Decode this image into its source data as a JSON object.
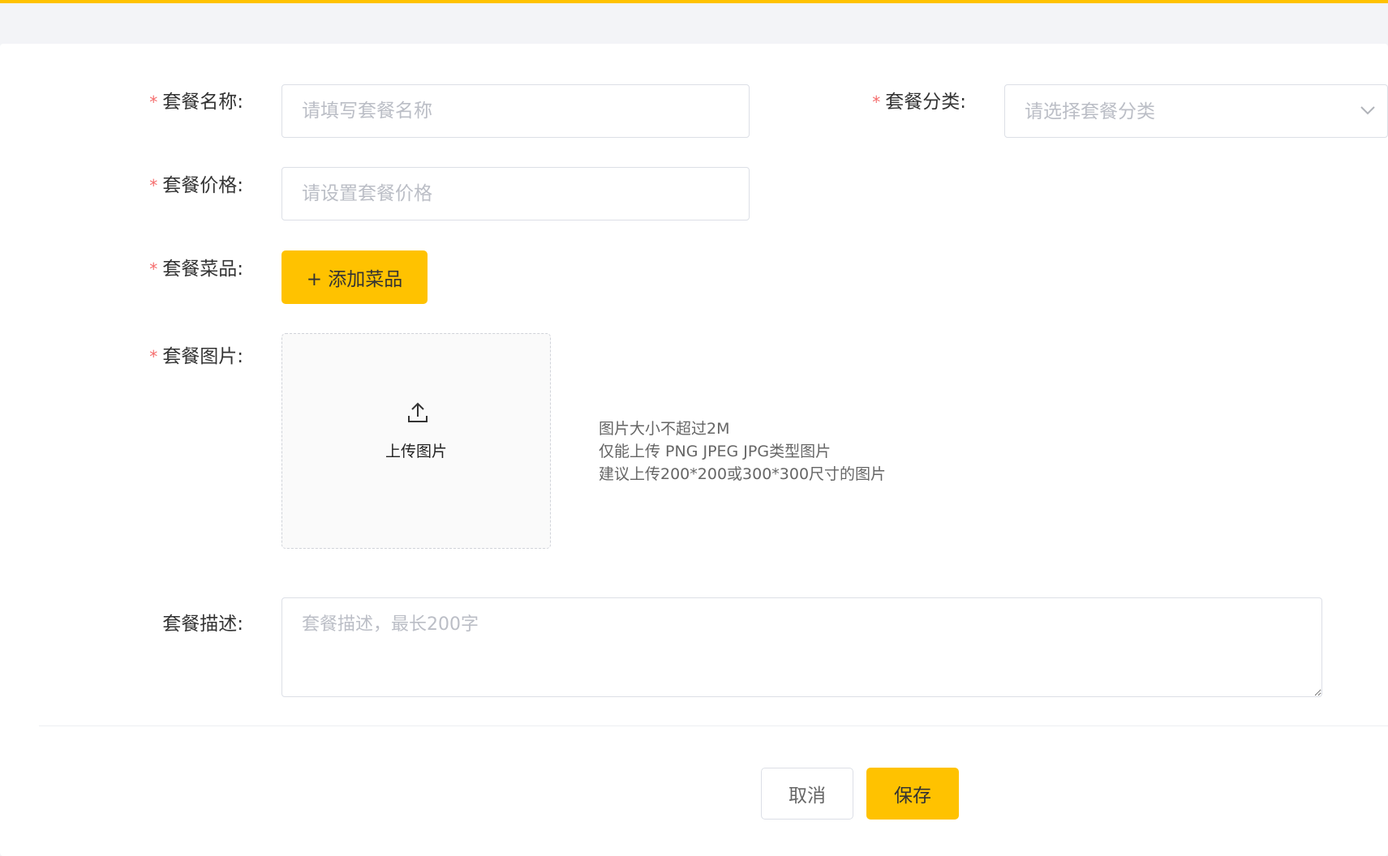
{
  "colors": {
    "accent": "#ffc200",
    "required_star": "#f56c6c",
    "placeholder": "#bbbec6"
  },
  "form": {
    "name": {
      "required_mark": "*",
      "label": "套餐名称:",
      "placeholder": "请填写套餐名称"
    },
    "category": {
      "required_mark": "*",
      "label": "套餐分类:",
      "placeholder": "请选择套餐分类"
    },
    "price": {
      "required_mark": "*",
      "label": "套餐价格:",
      "placeholder": "请设置套餐价格"
    },
    "dishes": {
      "required_mark": "*",
      "label": "套餐菜品:",
      "add_button": "+ 添加菜品"
    },
    "image": {
      "required_mark": "*",
      "label": "套餐图片:",
      "upload_icon": "upload-icon",
      "upload_text": "上传图片",
      "hints": [
        "图片大小不超过2M",
        "仅能上传 PNG JPEG JPG类型图片",
        "建议上传200*200或300*300尺寸的图片"
      ]
    },
    "description": {
      "label": "套餐描述:",
      "placeholder": "套餐描述，最长200字"
    }
  },
  "actions": {
    "cancel": "取消",
    "save": "保存"
  }
}
